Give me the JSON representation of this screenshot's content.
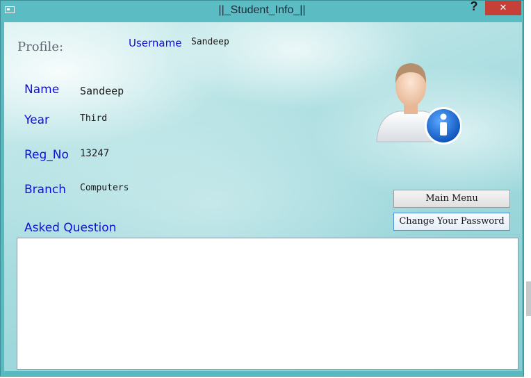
{
  "window": {
    "title": "||_Student_Info_||",
    "help_label": "?",
    "close_label": "✕"
  },
  "profile": {
    "heading": "Profile:",
    "username_label": "Username",
    "username_value": "Sandeep"
  },
  "fields": {
    "name_label": "Name",
    "name_value": "Sandeep",
    "year_label": "Year",
    "year_value": "Third",
    "reg_label": "Reg_No",
    "reg_value": "13247",
    "branch_label": "Branch",
    "branch_value": "Computers"
  },
  "questions": {
    "label": "Asked Question",
    "content": ""
  },
  "buttons": {
    "main_menu": "Main Menu",
    "change_password": "Change Your Password"
  },
  "icons": {
    "window": "window-app-icon",
    "avatar": "user-info-icon"
  },
  "colors": {
    "titlebar": "#5cbcc3",
    "close_button": "#c64038",
    "label_blue": "#1010d8"
  }
}
